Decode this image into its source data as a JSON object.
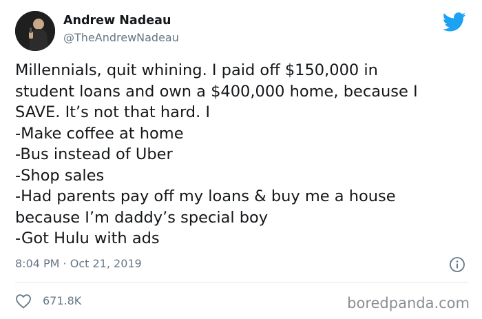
{
  "author": {
    "display_name": "Andrew Nadeau",
    "handle": "@TheAndrewNadeau",
    "avatar_icon": "avatar-photo"
  },
  "tweet": {
    "lines": [
      "Millennials, quit whining. I paid off $150,000 in",
      "student loans and own a $400,000 home, because I",
      "SAVE. It’s not that hard. I",
      "-Make coffee at home",
      "-Bus instead of Uber",
      "-Shop sales",
      "-Had parents pay off my loans & buy me a house",
      "because I’m daddy’s special boy",
      "-Got Hulu with ads"
    ],
    "timestamp": "8:04 PM · Oct 21, 2019",
    "likes": "671.8K"
  },
  "icons": {
    "brand": "twitter-bird-icon",
    "info": "info-icon",
    "like": "heart-icon"
  },
  "watermark": "boredpanda.com",
  "colors": {
    "twitter_blue": "#1da1f2",
    "secondary_text": "#657786",
    "primary_text": "#14171a",
    "like_red": "#e0245e"
  }
}
